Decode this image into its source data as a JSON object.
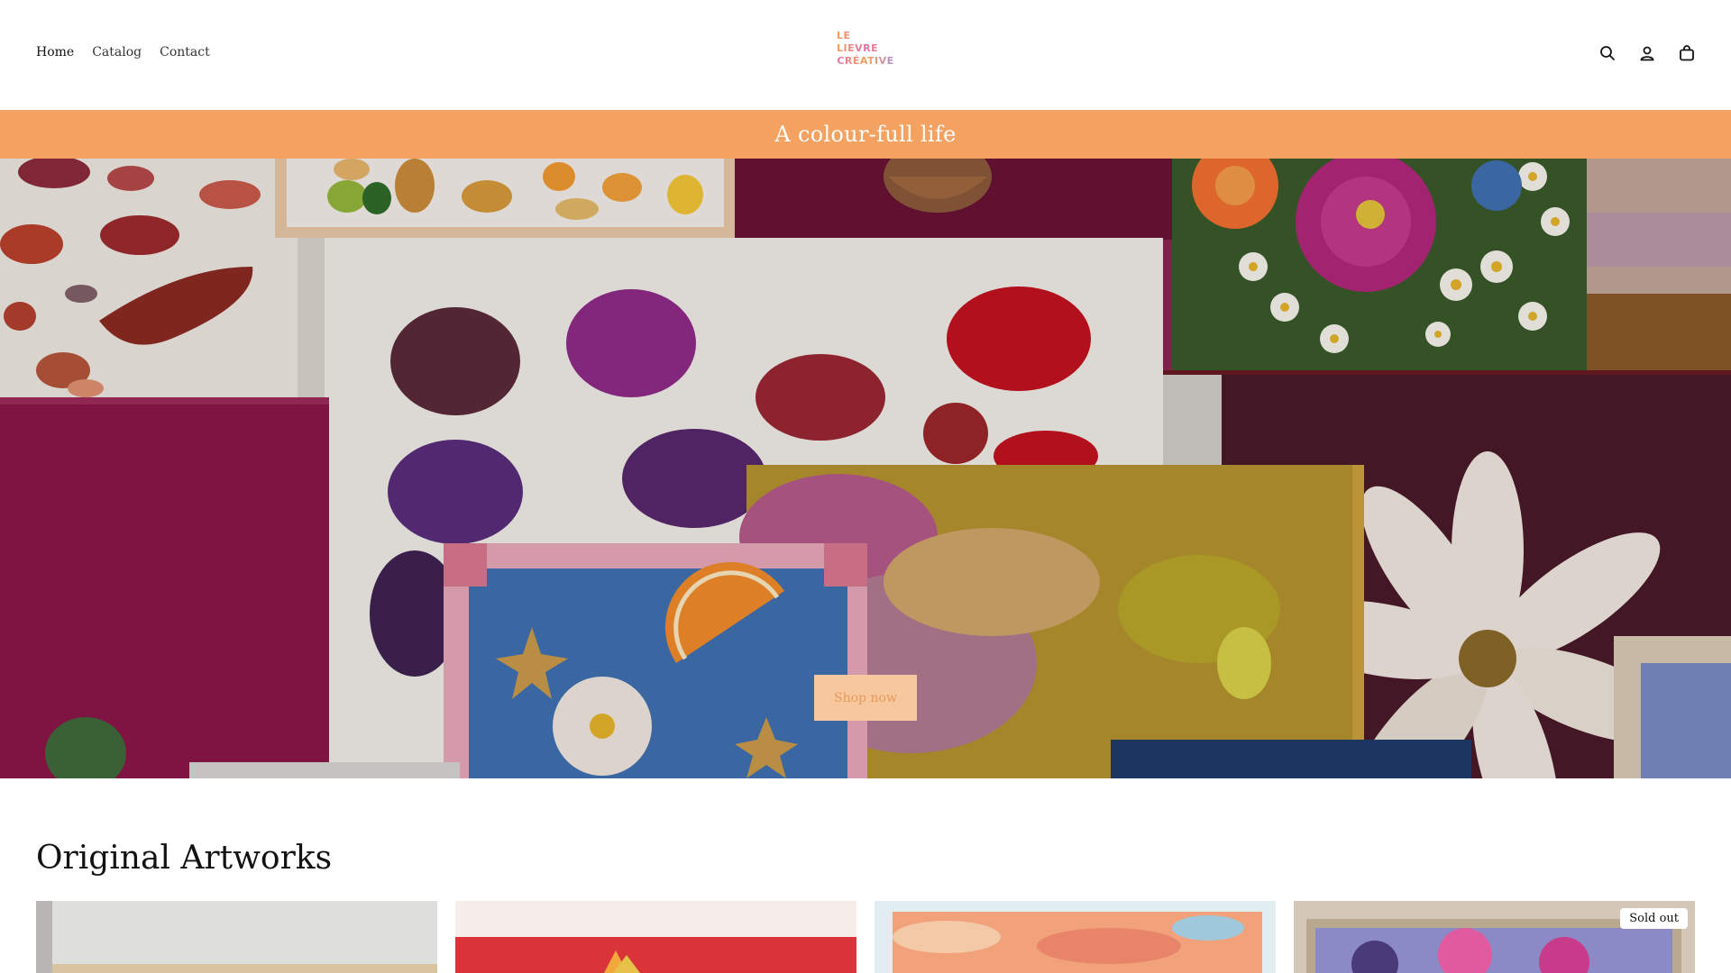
{
  "header": {
    "nav": [
      {
        "label": "Home",
        "active": true
      },
      {
        "label": "Catalog",
        "active": false
      },
      {
        "label": "Contact",
        "active": false
      }
    ],
    "logo": {
      "line1": "LE LIEVRE",
      "line2": "CRÉATIVE"
    },
    "icons": [
      "search-icon",
      "account-icon",
      "cart-icon"
    ]
  },
  "announcement": {
    "text": "A colour-full life",
    "background": "#f4a261"
  },
  "hero": {
    "button_label": "Shop now"
  },
  "collection": {
    "title": "Original Artworks",
    "products": [
      {
        "badge": ""
      },
      {
        "badge": ""
      },
      {
        "badge": ""
      },
      {
        "badge": "Sold out"
      }
    ]
  }
}
